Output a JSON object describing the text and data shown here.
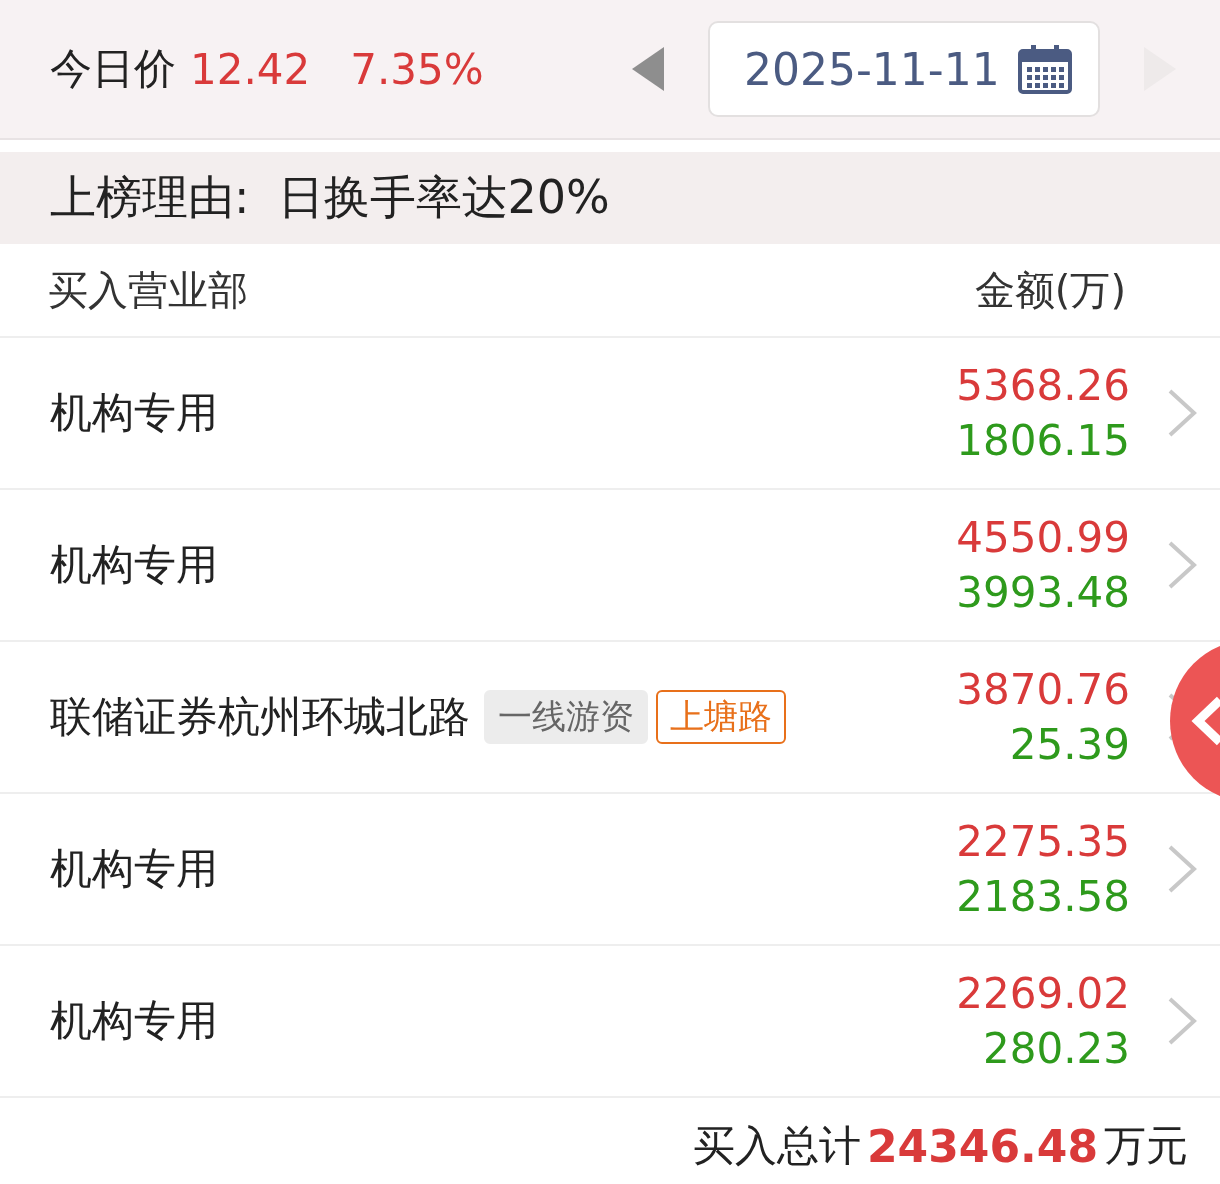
{
  "price_bar": {
    "label": "今日价",
    "price": "12.42",
    "change": "7.35%",
    "prev_disabled": false,
    "next_disabled": true,
    "date": "2025-11-11"
  },
  "reason": {
    "label": "上榜理由:",
    "text": "日换手率达20%"
  },
  "table": {
    "columns": [
      "买入营业部",
      "金额(万)"
    ],
    "rows": [
      {
        "name": "机构专用",
        "tags": [],
        "buy": "5368.26",
        "sell": "1806.15"
      },
      {
        "name": "机构专用",
        "tags": [],
        "buy": "4550.99",
        "sell": "3993.48"
      },
      {
        "name": "联储证券杭州环城北路",
        "tags": [
          {
            "label": "一线游资",
            "kind": "category"
          },
          {
            "label": "上塘路",
            "kind": "group"
          }
        ],
        "buy": "3870.76",
        "sell": "25.39"
      },
      {
        "name": "机构专用",
        "tags": [],
        "buy": "2275.35",
        "sell": "2183.58"
      },
      {
        "name": "机构专用",
        "tags": [],
        "buy": "2269.02",
        "sell": "280.23"
      }
    ]
  },
  "total": {
    "label": "买入总计",
    "value": "24346.48",
    "unit": "万元"
  }
}
